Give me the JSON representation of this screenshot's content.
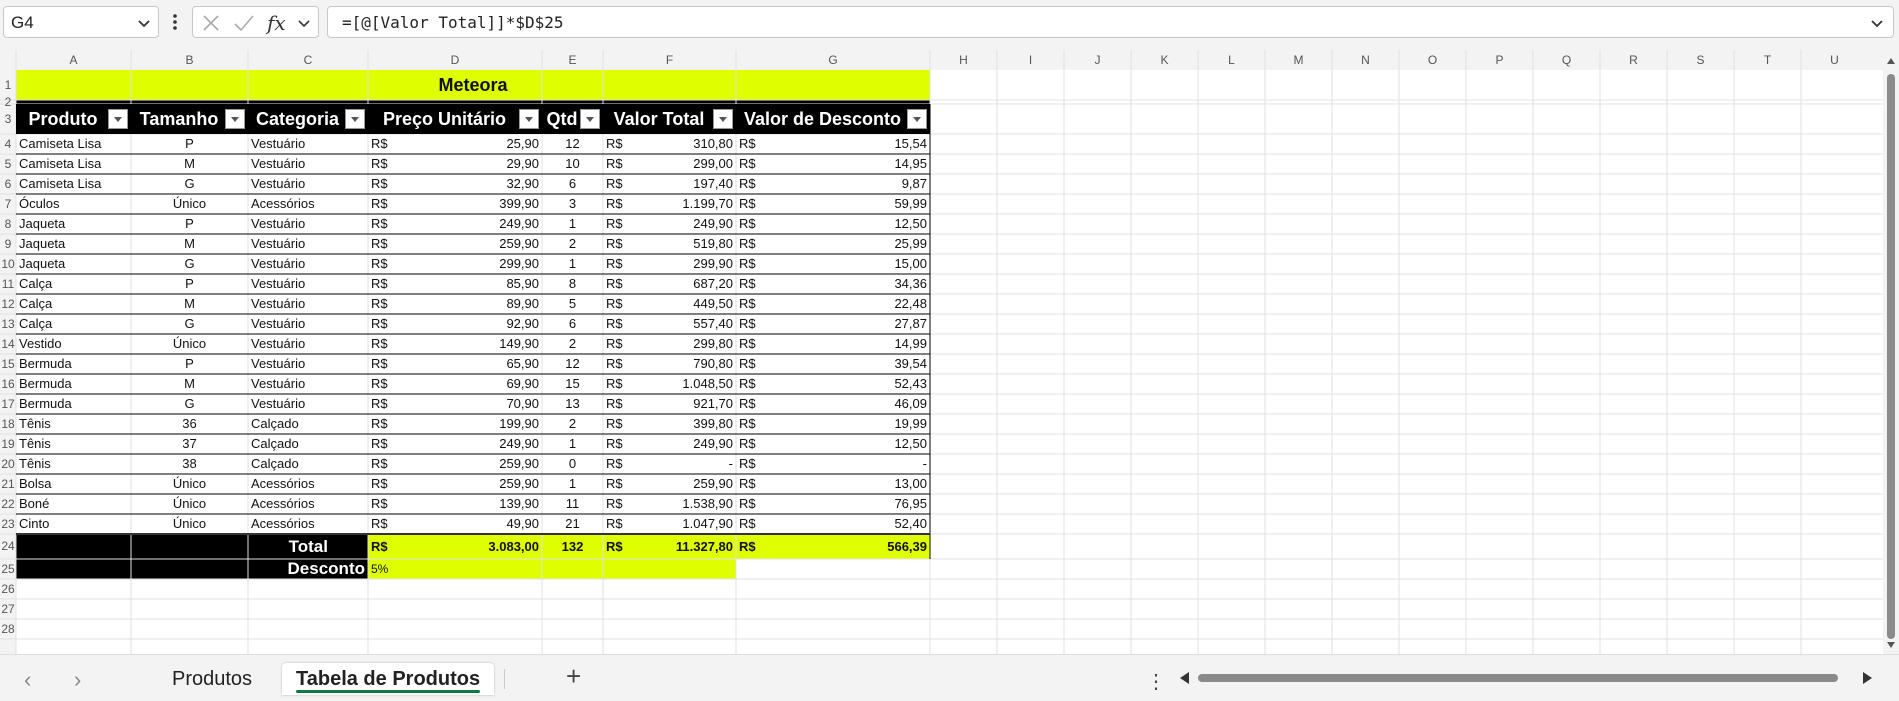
{
  "formula_bar": {
    "name_box": "G4",
    "formula": "=[@[Valor Total]]*$D$25"
  },
  "columns": [
    "A",
    "B",
    "C",
    "D",
    "E",
    "F",
    "G",
    "H",
    "I",
    "J",
    "K",
    "L",
    "M",
    "N",
    "O",
    "P",
    "Q",
    "R",
    "S",
    "T",
    "U"
  ],
  "rows": [
    "1",
    "2",
    "3",
    "4",
    "5",
    "6",
    "7",
    "8",
    "9",
    "10",
    "11",
    "12",
    "13",
    "14",
    "15",
    "16",
    "17",
    "18",
    "19",
    "20",
    "21",
    "22",
    "23",
    "24",
    "25",
    "26",
    "27",
    "28"
  ],
  "sheet": {
    "title": "Meteora",
    "headers": [
      "Produto",
      "Tamanho",
      "Categoria",
      "Preço Unitário",
      "Qtd",
      "Valor Total",
      "Valor de Desconto"
    ],
    "currency": "R$",
    "data": [
      [
        "Camiseta Lisa",
        "P",
        "Vestuário",
        "25,90",
        "12",
        "310,80",
        "15,54"
      ],
      [
        "Camiseta Lisa",
        "M",
        "Vestuário",
        "29,90",
        "10",
        "299,00",
        "14,95"
      ],
      [
        "Camiseta Lisa",
        "G",
        "Vestuário",
        "32,90",
        "6",
        "197,40",
        "9,87"
      ],
      [
        "Óculos",
        "Único",
        "Acessórios",
        "399,90",
        "3",
        "1.199,70",
        "59,99"
      ],
      [
        "Jaqueta",
        "P",
        "Vestuário",
        "249,90",
        "1",
        "249,90",
        "12,50"
      ],
      [
        "Jaqueta",
        "M",
        "Vestuário",
        "259,90",
        "2",
        "519,80",
        "25,99"
      ],
      [
        "Jaqueta",
        "G",
        "Vestuário",
        "299,90",
        "1",
        "299,90",
        "15,00"
      ],
      [
        "Calça",
        "P",
        "Vestuário",
        "85,90",
        "8",
        "687,20",
        "34,36"
      ],
      [
        "Calça",
        "M",
        "Vestuário",
        "89,90",
        "5",
        "449,50",
        "22,48"
      ],
      [
        "Calça",
        "G",
        "Vestuário",
        "92,90",
        "6",
        "557,40",
        "27,87"
      ],
      [
        "Vestido",
        "Único",
        "Vestuário",
        "149,90",
        "2",
        "299,80",
        "14,99"
      ],
      [
        "Bermuda",
        "P",
        "Vestuário",
        "65,90",
        "12",
        "790,80",
        "39,54"
      ],
      [
        "Bermuda",
        "M",
        "Vestuário",
        "69,90",
        "15",
        "1.048,50",
        "52,43"
      ],
      [
        "Bermuda",
        "G",
        "Vestuário",
        "70,90",
        "13",
        "921,70",
        "46,09"
      ],
      [
        "Tênis",
        "36",
        "Calçado",
        "199,90",
        "2",
        "399,80",
        "19,99"
      ],
      [
        "Tênis",
        "37",
        "Calçado",
        "249,90",
        "1",
        "249,90",
        "12,50"
      ],
      [
        "Tênis",
        "38",
        "Calçado",
        "259,90",
        "0",
        "-",
        "-"
      ],
      [
        "Bolsa",
        "Único",
        "Acessórios",
        "259,90",
        "1",
        "259,90",
        "13,00"
      ],
      [
        "Boné",
        "Único",
        "Acessórios",
        "139,90",
        "11",
        "1.538,90",
        "76,95"
      ],
      [
        "Cinto",
        "Único",
        "Acessórios",
        "49,90",
        "21",
        "1.047,90",
        "52,40"
      ]
    ],
    "total": {
      "label": "Total",
      "preco": "3.083,00",
      "qtd": "132",
      "valor_total": "11.327,80",
      "desconto": "566,39"
    },
    "desconto": {
      "label": "Desconto",
      "value": "5%"
    }
  },
  "tabs": {
    "sheet1": "Produtos",
    "sheet2": "Tabela de Produtos"
  },
  "colors": {
    "highlight": "#dfff00",
    "header_bg": "#000000",
    "tab_underline": "#107c41"
  }
}
